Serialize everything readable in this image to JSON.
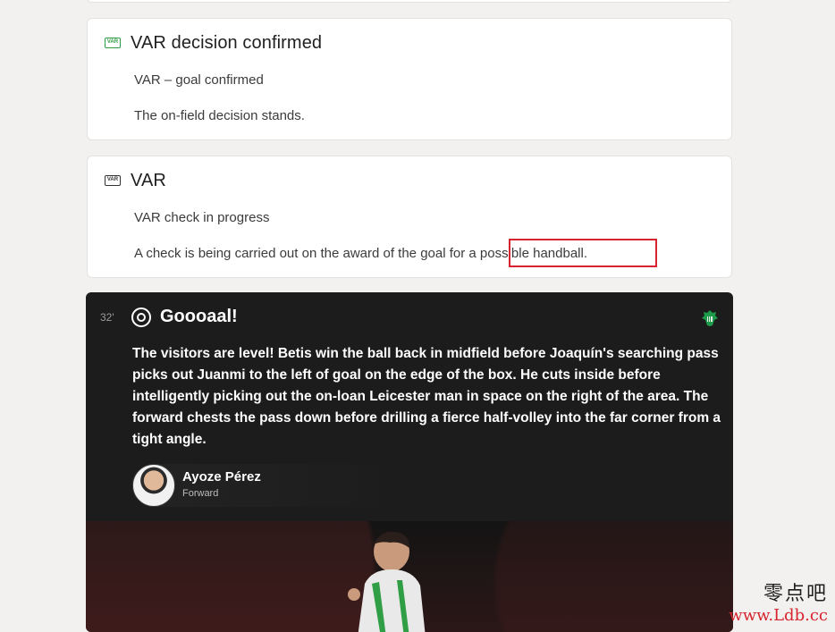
{
  "var_confirmed": {
    "title": "VAR decision confirmed",
    "icon_label": "VAR",
    "line1": "VAR – goal confirmed",
    "line2": "The on-field decision stands."
  },
  "var_check": {
    "title": "VAR",
    "icon_label": "VAR",
    "line1": "VAR check in progress",
    "line2": "A check is being carried out on the award of the goal for a possible handball."
  },
  "goal": {
    "minute": "32'",
    "title": "Goooaal!",
    "text": "The visitors are level! Betis win the ball back in midfield before Joaquín's searching pass picks out Juanmi to the left of goal on the edge of the box. He cuts inside before intelligently picking out the on-loan Leicester man in space on the right of the area. The forward chests the pass down before drilling a fierce half-volley into the far corner from a tight angle.",
    "player_name": "Ayoze Pérez",
    "player_position": "Forward"
  },
  "watermark": {
    "chinese": "零点吧",
    "url": "www.Ldb.cc"
  },
  "colors": {
    "highlight": "#d6252e",
    "var_confirmed": "#2f9e44",
    "goal_card_bg": "#1c1c1c"
  },
  "icons": [
    "var-icon",
    "goal-ball-icon",
    "club-crest-icon"
  ]
}
